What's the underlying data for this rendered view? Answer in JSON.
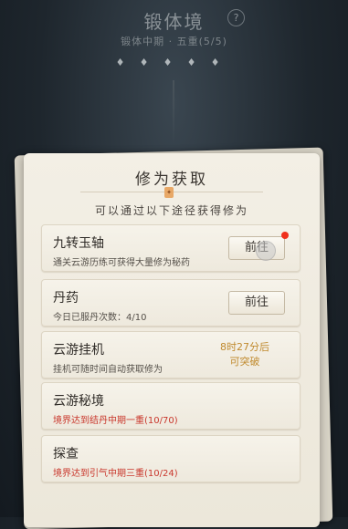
{
  "background": {
    "realm_title": "锻体境",
    "help_icon": "?",
    "realm_stage": "锻体中期 · 五重(5/5)"
  },
  "panel": {
    "title": "修为获取",
    "subtitle": "可以通过以下途径获得修为",
    "items": [
      {
        "name": "九转玉轴",
        "desc": "通关云游历练可获得大量修为秘药",
        "button": "前往",
        "has_notification": true
      },
      {
        "name": "丹药",
        "desc": "今日已服丹次数：4/10",
        "button": "前往"
      },
      {
        "name": "云游挂机",
        "desc": "挂机可随时间自动获取修为",
        "timer_line1": "8时27分后",
        "timer_line2": "可突破"
      },
      {
        "name": "云游秘境",
        "desc": "境界达到结丹中期一重(10/70)"
      },
      {
        "name": "探查",
        "desc": "境界达到引气中期三重(10/24)"
      }
    ]
  },
  "colors": {
    "accent_red": "#c9372c",
    "timer_gold": "#c08a2e",
    "notification": "#f0301c"
  }
}
